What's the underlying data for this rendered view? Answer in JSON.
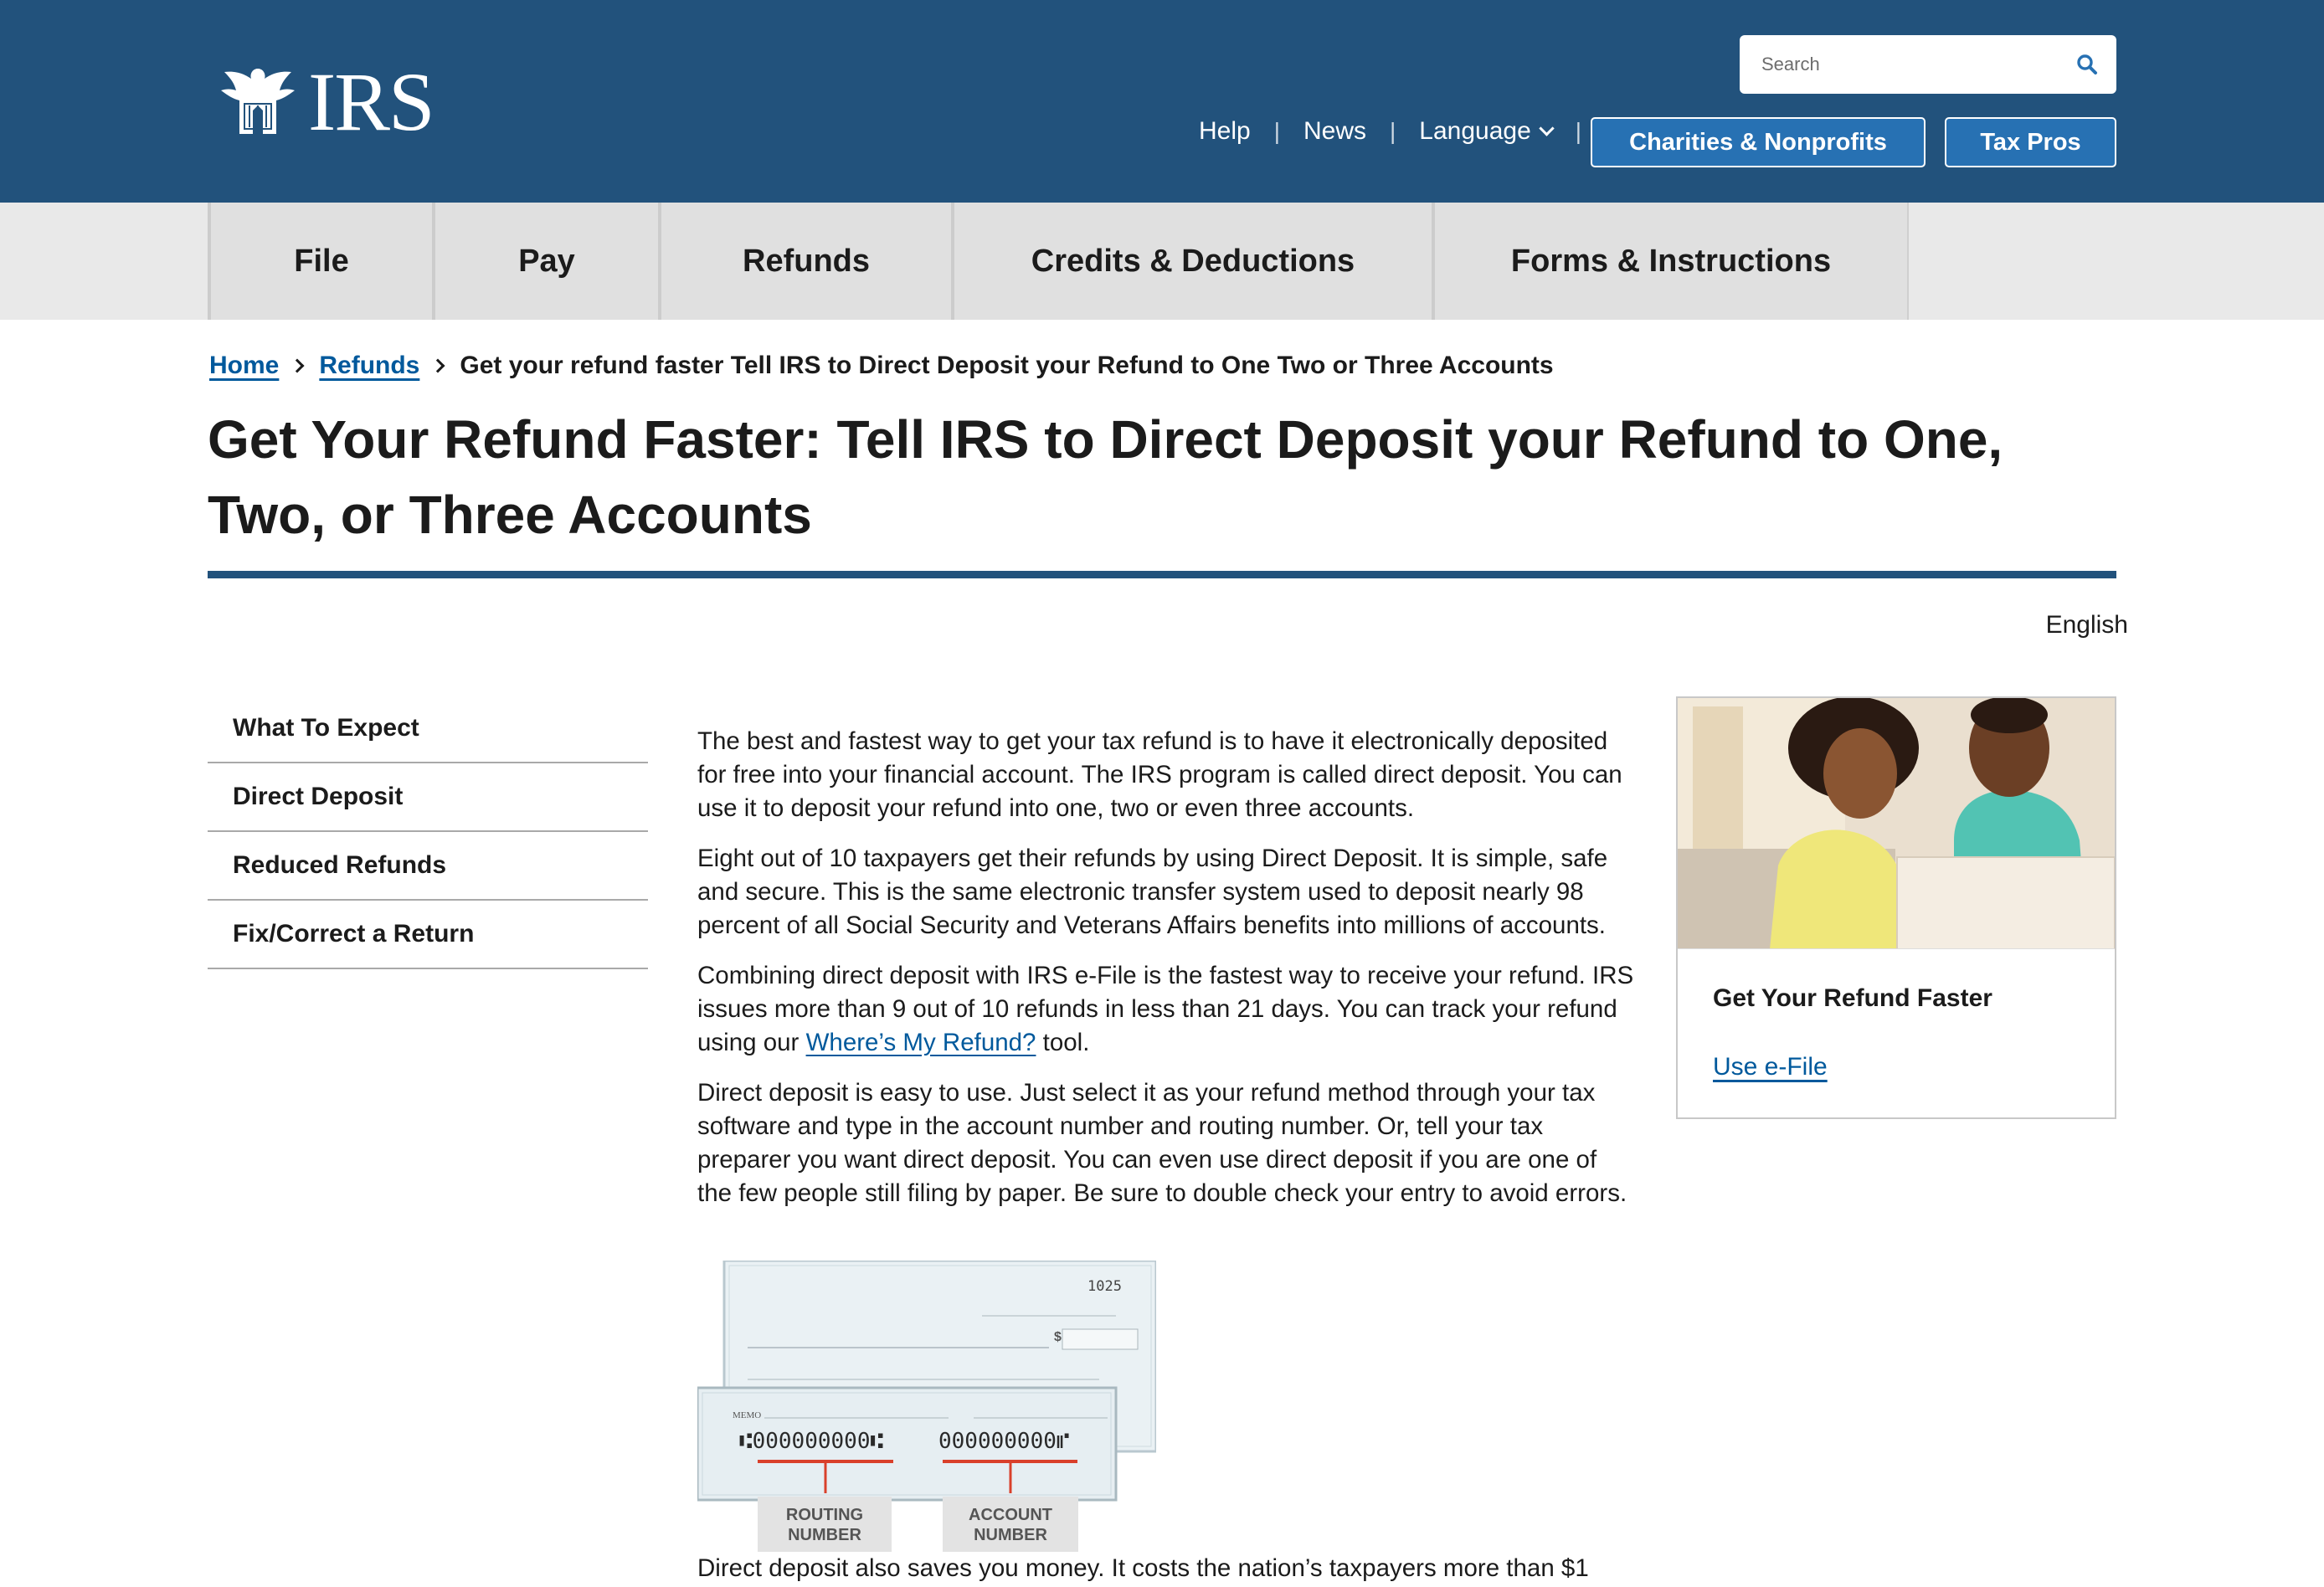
{
  "header": {
    "logo_text": "IRS",
    "search_placeholder": "Search",
    "links": [
      "Help",
      "News",
      "Language"
    ],
    "buttons": {
      "charities": "Charities & Nonprofits",
      "taxpros": "Tax Pros"
    }
  },
  "mainnav": [
    "File",
    "Pay",
    "Refunds",
    "Credits & Deductions",
    "Forms & Instructions"
  ],
  "breadcrumb": {
    "home": "Home",
    "refunds": "Refunds",
    "current": "Get your refund faster Tell IRS to Direct Deposit your Refund to One Two or Three Accounts"
  },
  "page_title": "Get Your Refund Faster: Tell IRS to Direct Deposit your Refund to One, Two, or Three Accounts",
  "language_label": "English",
  "sidenav": [
    "What To Expect",
    "Direct Deposit",
    "Reduced Refunds",
    "Fix/Correct a Return"
  ],
  "content": {
    "p1": "The best and fastest way to get your tax refund is to have it electronically deposited for free into your financial account. The IRS program is called direct deposit. You can use it to deposit your refund into one, two or even three accounts.",
    "p2": "Eight out of 10 taxpayers get their refunds by using Direct Deposit. It is simple, safe and secure. This is the same electronic transfer system used to deposit nearly 98 percent of all Social Security and Veterans Affairs benefits into millions of accounts.",
    "p3_before": "Combining direct deposit with IRS e-File is the fastest way to receive your refund. IRS issues more than 9 out of 10 refunds in less than 21 days. You can track your refund using our ",
    "p3_link": "Where’s My Refund?",
    "p3_after": " tool.",
    "p4": "Direct deposit is easy to use. Just select it as your refund method through your tax software and type in the account number and routing number. Or, tell your tax preparer you want direct deposit. You can even use direct deposit if you are one of the few people still filing by paper. Be sure to double check your entry to avoid errors.",
    "p5": "Direct deposit also saves you money. It costs the nation’s taxpayers more than $1"
  },
  "check_image": {
    "check_number": "1025",
    "memo": "MEMO",
    "routing_digits": "⑆000000000⑆",
    "account_digits": "000000000⑈",
    "routing_label_1": "ROUTING",
    "routing_label_2": "NUMBER",
    "account_label_1": "ACCOUNT",
    "account_label_2": "NUMBER",
    "dollar_sign": "$"
  },
  "card": {
    "title": "Get Your Refund Faster",
    "link": "Use e-File"
  },
  "colors": {
    "header_blue": "#22527c",
    "button_blue": "#2771b3",
    "link_blue": "#00599c",
    "nav_gray": "#e0e0e0"
  }
}
